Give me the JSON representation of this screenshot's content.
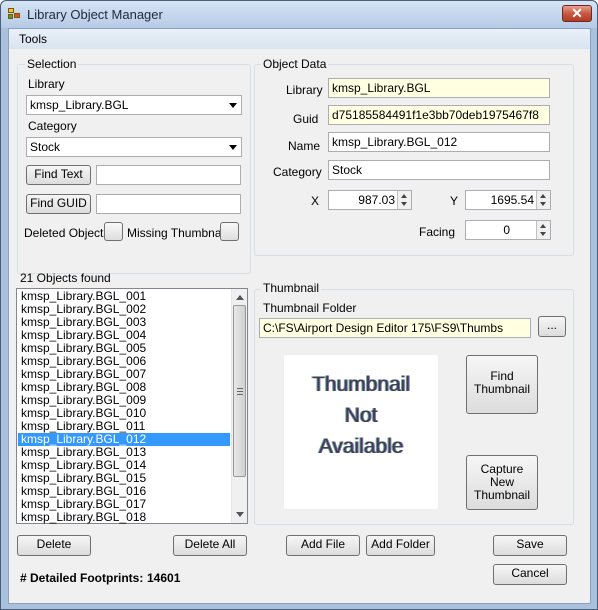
{
  "window": {
    "title": "Library Object Manager",
    "close_glyph": "✕"
  },
  "menu": {
    "items": [
      "Tools"
    ]
  },
  "selection": {
    "group_title": "Selection",
    "library_label": "Library",
    "library_value": "kmsp_Library.BGL",
    "category_label": "Category",
    "category_value": "Stock",
    "find_text_button": "Find Text",
    "find_text_value": "",
    "find_guid_button": "Find GUID",
    "find_guid_value": "",
    "deleted_objects_label": "Deleted Objects",
    "missing_thumbnail_label": "Missing Thumbnail"
  },
  "object_data": {
    "group_title": "Object Data",
    "library_label": "Library",
    "library_value": "kmsp_Library.BGL",
    "guid_label": "Guid",
    "guid_value": "d75185584491f1e3bb70deb1975467f8",
    "name_label": "Name",
    "name_value": "kmsp_Library.BGL_012",
    "category_label": "Category",
    "category_value": "Stock",
    "x_label": "X",
    "x_value": "987.03",
    "y_label": "Y",
    "y_value": "1695.54",
    "facing_label": "Facing",
    "facing_value": "0"
  },
  "objects": {
    "count_label": "21 Objects found",
    "items": [
      "kmsp_Library.BGL_001",
      "kmsp_Library.BGL_002",
      "kmsp_Library.BGL_003",
      "kmsp_Library.BGL_004",
      "kmsp_Library.BGL_005",
      "kmsp_Library.BGL_006",
      "kmsp_Library.BGL_007",
      "kmsp_Library.BGL_008",
      "kmsp_Library.BGL_009",
      "kmsp_Library.BGL_010",
      "kmsp_Library.BGL_011",
      "kmsp_Library.BGL_012",
      "kmsp_Library.BGL_013",
      "kmsp_Library.BGL_014",
      "kmsp_Library.BGL_015",
      "kmsp_Library.BGL_016",
      "kmsp_Library.BGL_017",
      "kmsp_Library.BGL_018"
    ],
    "selected_index": 11,
    "delete_button": "Delete",
    "delete_all_button": "Delete All"
  },
  "thumbnail": {
    "group_title": "Thumbnail",
    "folder_label": "Thumbnail Folder",
    "folder_value": "C:\\FS\\Airport Design Editor 175\\FS9\\Thumbs",
    "browse_button": "...",
    "placeholder_lines": [
      "Thumbnail",
      "Not",
      "Available"
    ],
    "find_button_lines": [
      "Find",
      "Thumbnail"
    ],
    "capture_button_lines": [
      "Capture",
      "New",
      "Thumbnail"
    ]
  },
  "actions": {
    "add_file": "Add File",
    "add_folder": "Add Folder",
    "save": "Save",
    "cancel": "Cancel"
  },
  "footer": {
    "footprints_label": "# Detailed Footprints:",
    "footprints_value": "14601"
  }
}
